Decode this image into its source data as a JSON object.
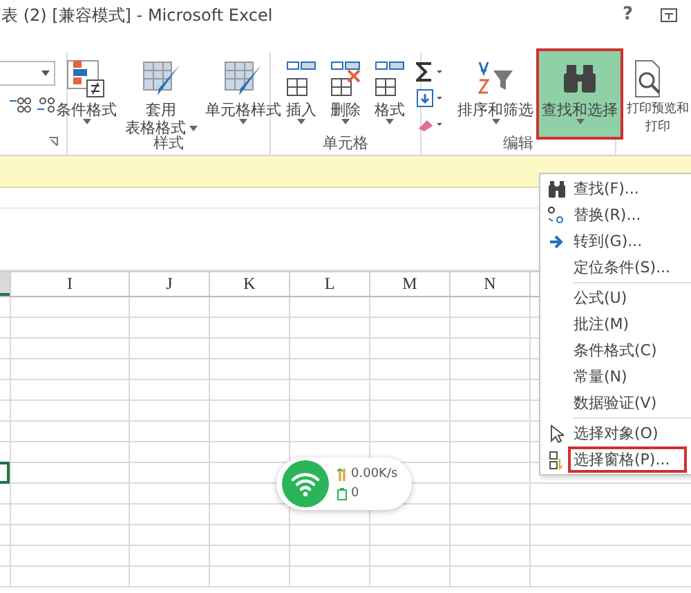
{
  "window": {
    "title": "表 (2)  [兼容模式] - Microsoft Excel",
    "help": "?"
  },
  "ribbon": {
    "groups": [
      {
        "label": "样式",
        "buttons": [
          {
            "label_lines": [
              "条件格式"
            ],
            "dropdown": true,
            "selected": false
          },
          {
            "label_lines": [
              "套用",
              "表格格式"
            ],
            "dropdown": true,
            "selected": false
          },
          {
            "label_lines": [
              "单元格样式"
            ],
            "dropdown": true,
            "selected": false
          }
        ]
      },
      {
        "label": "单元格",
        "buttons": [
          {
            "label_lines": [
              "插入"
            ],
            "dropdown": true,
            "selected": false
          },
          {
            "label_lines": [
              "删除"
            ],
            "dropdown": true,
            "selected": false
          },
          {
            "label_lines": [
              "格式"
            ],
            "dropdown": true,
            "selected": false
          }
        ]
      },
      {
        "label": "编辑",
        "buttons": [
          {
            "label_lines": [
              "排序和筛选"
            ],
            "dropdown": true,
            "selected": false
          },
          {
            "label_lines": [
              "查找和选择"
            ],
            "dropdown": true,
            "selected": true
          }
        ]
      },
      {
        "buttons": [
          {
            "label_lines": [
              "打印预览和",
              "打印"
            ],
            "dropdown": false,
            "selected": false
          }
        ]
      }
    ]
  },
  "columns": [
    "I",
    "J",
    "K",
    "L",
    "M",
    "N"
  ],
  "menu": {
    "sections": [
      {
        "items": [
          {
            "label": "查找(F)...",
            "highlighted": false
          },
          {
            "label": "替换(R)...",
            "highlighted": false
          },
          {
            "label": "转到(G)...",
            "highlighted": false
          },
          {
            "label": "定位条件(S)...",
            "highlighted": false
          }
        ]
      },
      {
        "items": [
          {
            "label": "公式(U)",
            "highlighted": false
          },
          {
            "label": "批注(M)",
            "highlighted": false
          },
          {
            "label": "条件格式(C)",
            "highlighted": false
          },
          {
            "label": "常量(N)",
            "highlighted": false
          },
          {
            "label": "数据验证(V)",
            "highlighted": false
          }
        ]
      },
      {
        "items": [
          {
            "label": "选择对象(O)",
            "highlighted": false
          },
          {
            "label": "选择窗格(P)...",
            "highlighted": true
          }
        ]
      }
    ]
  },
  "network_widget": {
    "speed": "0.00K/s",
    "count": "0"
  }
}
